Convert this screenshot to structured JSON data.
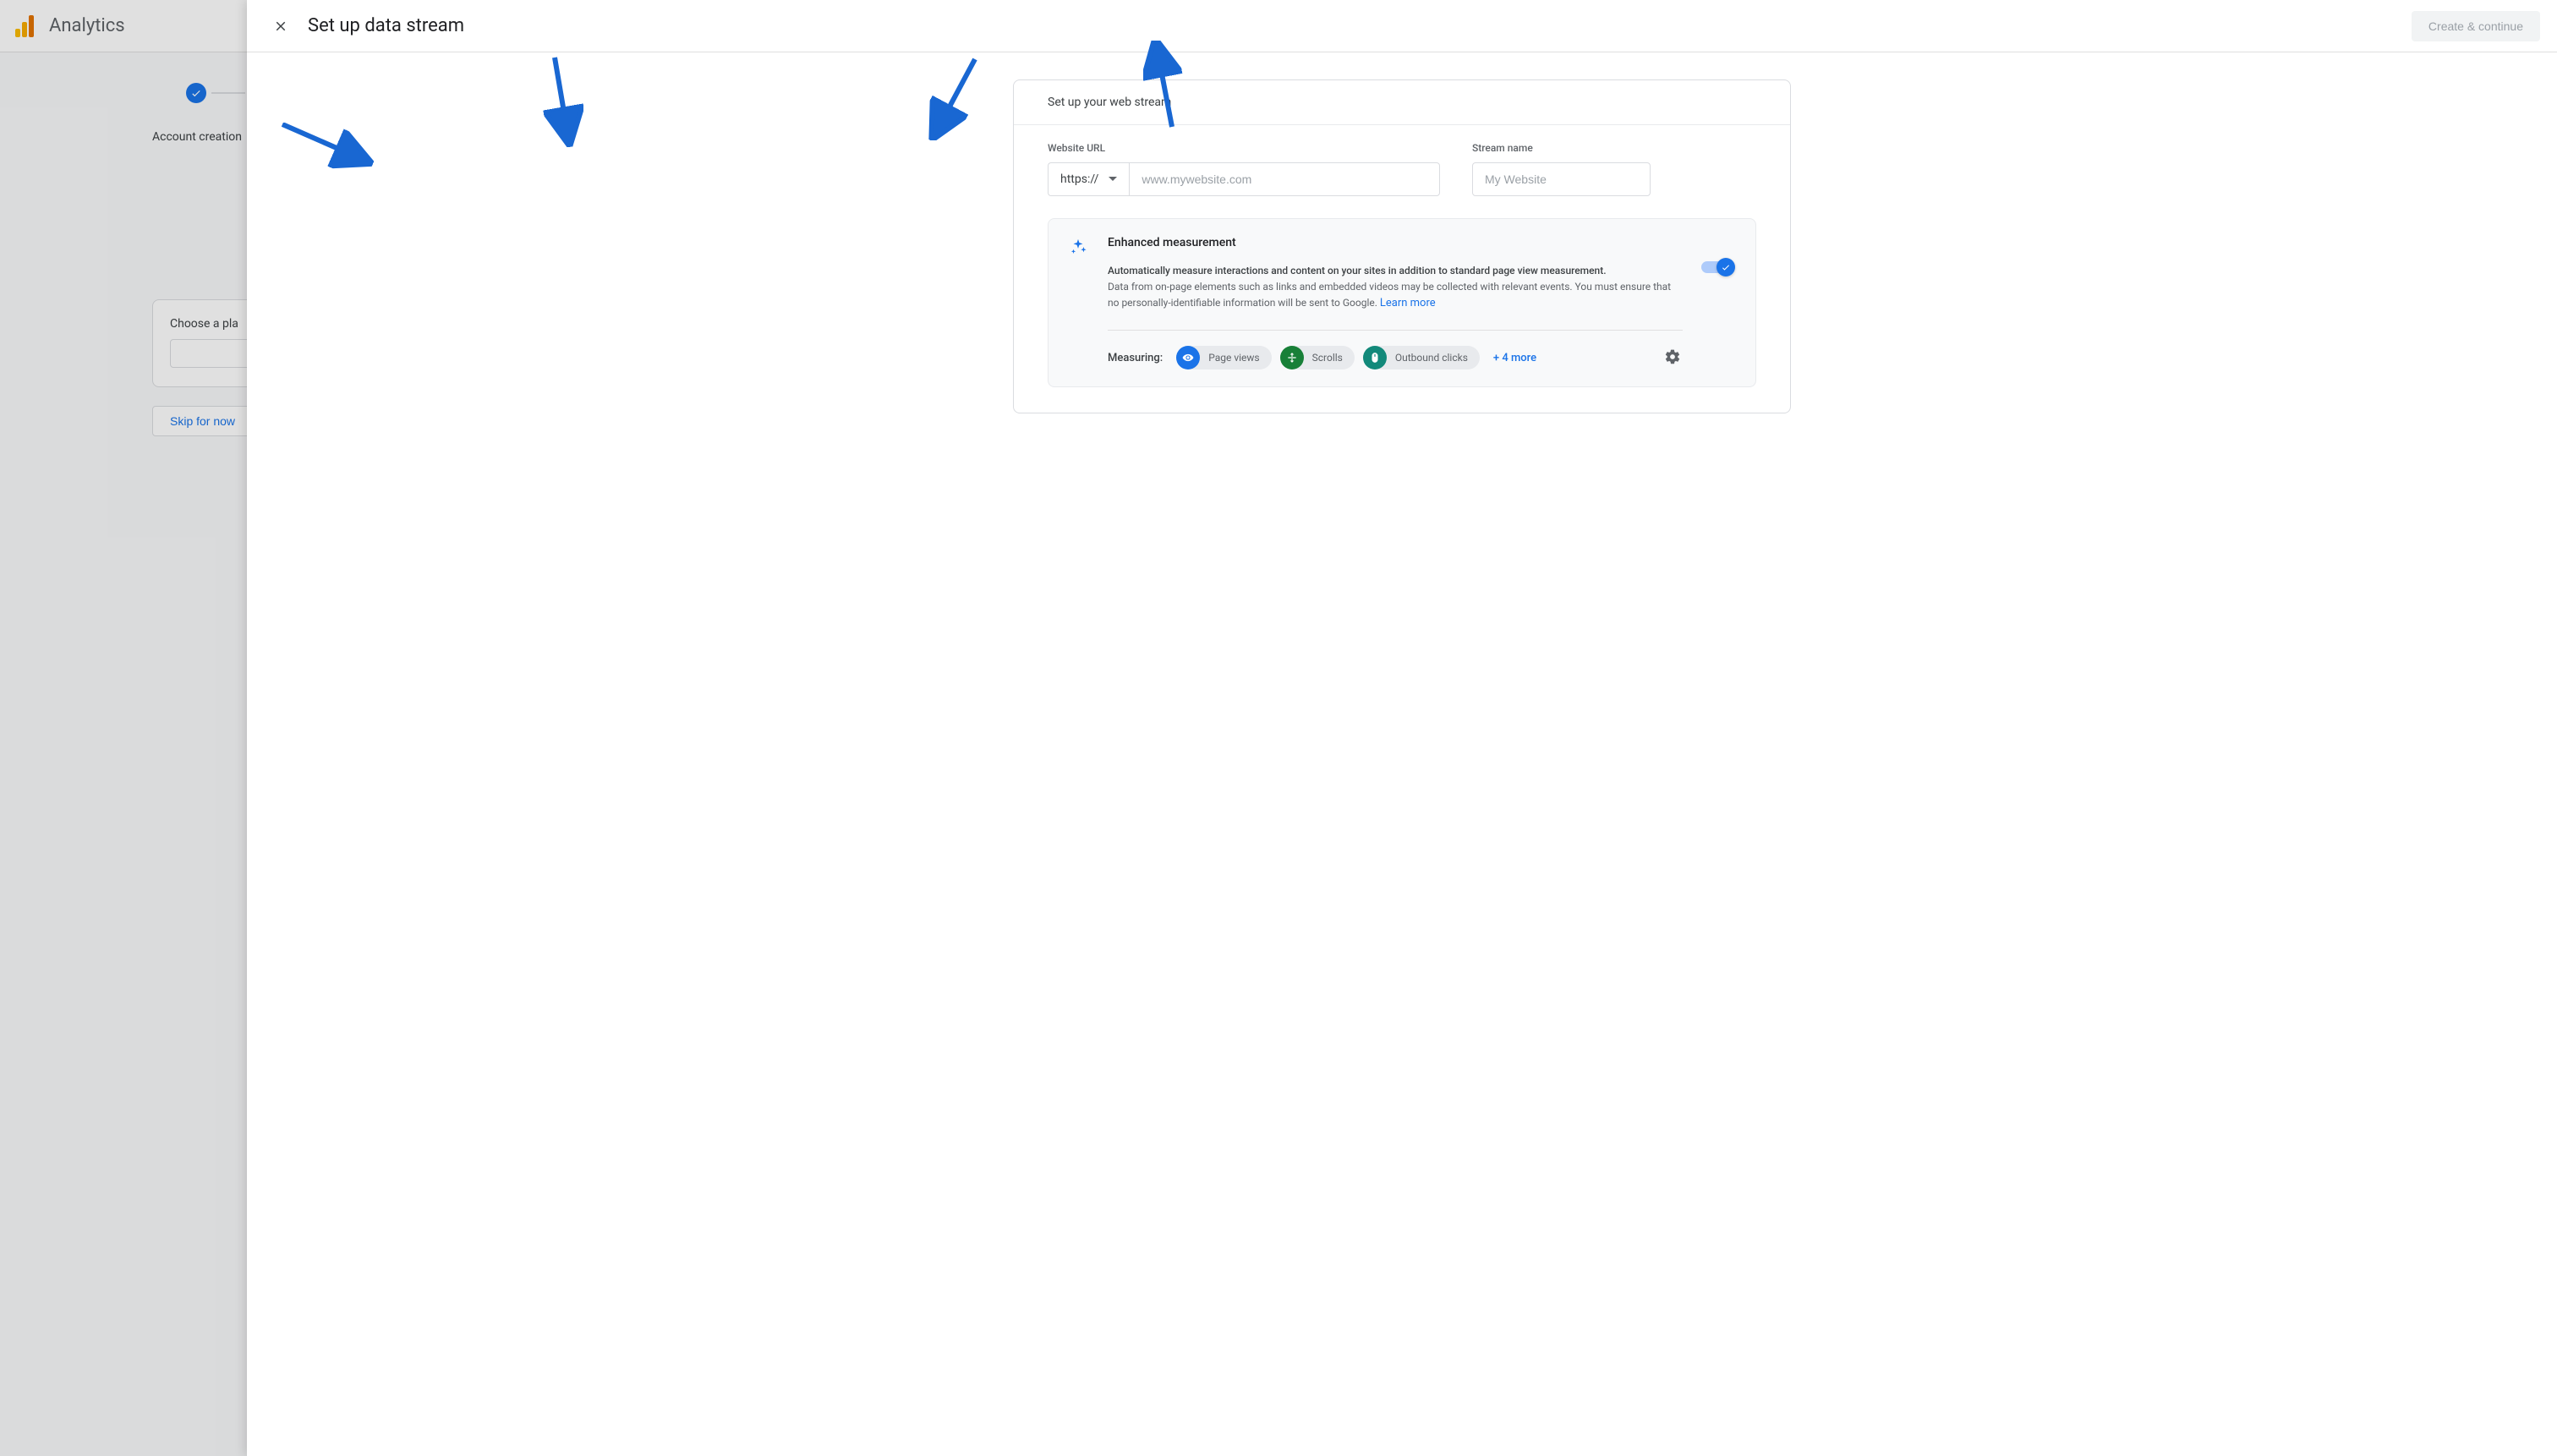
{
  "brand": "Analytics",
  "stepper": {
    "step1_label": "Account creation"
  },
  "bg": {
    "card_title": "Choose a pla",
    "skip_label": "Skip for now"
  },
  "panel": {
    "title": "Set up data stream",
    "create_btn": "Create & continue"
  },
  "card": {
    "head": "Set up your web stream",
    "url_label": "Website URL",
    "protocol": "https://",
    "url_placeholder": "www.mywebsite.com",
    "stream_label": "Stream name",
    "stream_placeholder": "My Website"
  },
  "em": {
    "title": "Enhanced measurement",
    "desc_line1": "Automatically measure interactions and content on your sites in addition to standard page view measurement.",
    "desc_line2": "Data from on-page elements such as links and embedded videos may be collected with relevant events. You must ensure that no personally-identifiable information will be sent to Google. ",
    "learn_more": "Learn more",
    "measuring_label": "Measuring:",
    "chips": {
      "pageviews": "Page views",
      "scrolls": "Scrolls",
      "outbound": "Outbound clicks"
    },
    "more": "+ 4 more"
  }
}
